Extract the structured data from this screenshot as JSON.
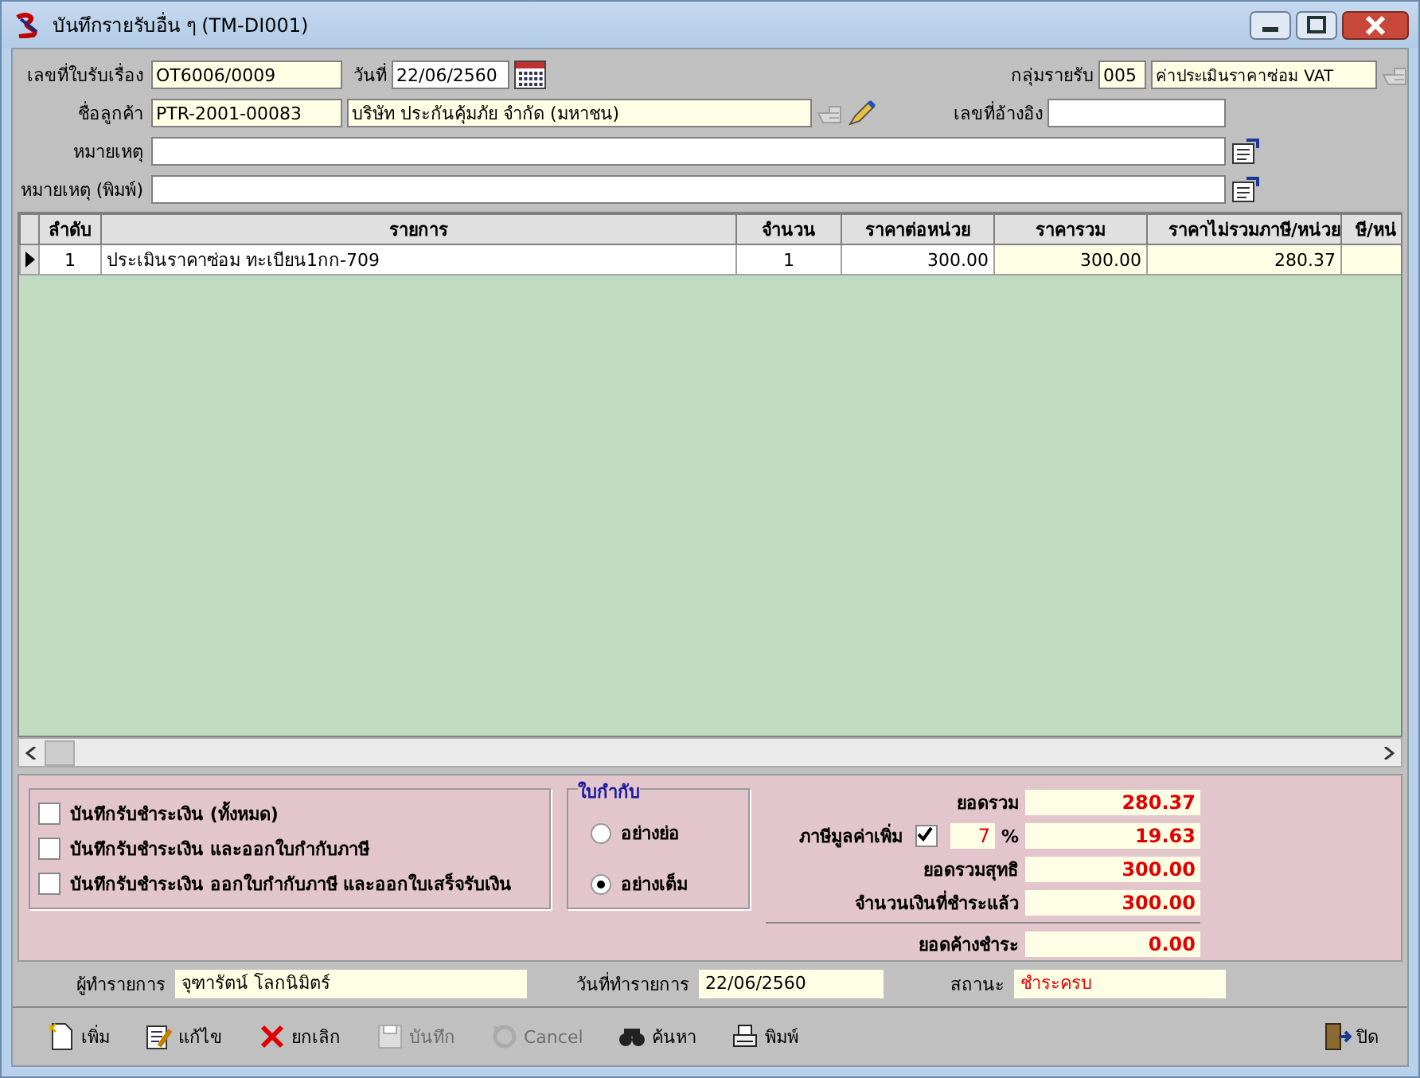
{
  "window": {
    "title": "บันทึกรายรับอื่น ๆ  (TM-DI001)"
  },
  "header": {
    "doc_no": {
      "label": "เลขที่ใบรับเรื่อง",
      "value": "OT6006/0009"
    },
    "date": {
      "label": "วันที่",
      "value": "22/06/2560"
    },
    "income_group": {
      "label": "กลุ่มรายรับ",
      "code": "005",
      "name": "ค่าประเมินราคาซ่อม VAT"
    },
    "customer": {
      "label": "ชื่อลูกค้า",
      "code": "PTR-2001-00083",
      "name": "บริษัท ประกันคุ้มภัย จำกัด (มหาชน)"
    },
    "reference": {
      "label": "เลขที่อ้างอิง"
    },
    "note": {
      "label": "หมายเหตุ"
    },
    "print_note": {
      "label": "หมายเหตุ (พิมพ์)"
    }
  },
  "table": {
    "columns": [
      "ลำดับ",
      "รายการ",
      "จำนวน",
      "ราคาต่อหน่วย",
      "ราคารวม",
      "ราคาไม่รวมภาษี/หน่วย",
      "ษี/หน่"
    ],
    "rows": [
      {
        "selected": true,
        "cells": [
          "1",
          "ประเมินราคาซ่อม ทะเบียน1กก-709",
          "1",
          "300.00",
          "300.00",
          "280.37"
        ]
      }
    ]
  },
  "options": {
    "checkboxes": [
      {
        "label": "บันทึกรับชำระเงิน (ทั้งหมด)",
        "checked": false
      },
      {
        "label": "บันทึกรับชำระเงิน และออกใบกำกับภาษี",
        "checked": false
      },
      {
        "label": "บันทึกรับชำระเงิน ออกใบกำกับภาษี และออกใบเสร็จรับเงิน",
        "checked": false
      }
    ],
    "invoice_type": {
      "title": "ใบกำกับ",
      "options": [
        {
          "label": "อย่างย่อ",
          "selected": false
        },
        {
          "label": "อย่างเต็ม",
          "selected": true
        }
      ]
    }
  },
  "totals": [
    {
      "kind": "plain",
      "label": "ยอดรวม",
      "value": "280.37"
    },
    {
      "kind": "vat",
      "label": "ภาษีมูลค่าเพิ่ม",
      "checked": true,
      "rate": "7",
      "unit": "%",
      "value": "19.63"
    },
    {
      "kind": "plain",
      "label": "ยอดรวมสุทธิ",
      "value": "300.00"
    },
    {
      "kind": "plain",
      "label": "จำนวนเงินที่ชำระแล้ว",
      "value": "300.00"
    },
    {
      "kind": "plain",
      "label": "ยอดค้างชำระ",
      "value": "0.00"
    }
  ],
  "info": [
    {
      "kind": "plain",
      "label": "ผู้ทำรายการ",
      "value": "จุฑารัตน์ โลกนิมิตร์"
    },
    {
      "kind": "plain",
      "label": "วันที่ทำรายการ",
      "value": "22/06/2560"
    },
    {
      "kind": "status",
      "label": "สถานะ",
      "value": "ชำระครบ"
    }
  ],
  "toolbar": [
    {
      "label": "เพิ่ม",
      "disabled": false
    },
    {
      "label": "แก้ไข",
      "disabled": false
    },
    {
      "label": "ยกเลิก",
      "disabled": false
    },
    {
      "label": "บันทึก",
      "disabled": true
    },
    {
      "label": "Cancel",
      "disabled": true
    },
    {
      "label": "ค้นหา",
      "disabled": false
    },
    {
      "label": "พิมพ์",
      "disabled": false
    },
    {
      "label": "ปิด",
      "disabled": false
    }
  ]
}
